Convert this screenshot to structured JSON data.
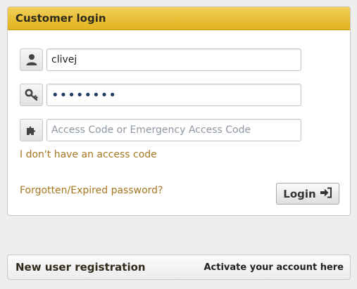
{
  "login_panel": {
    "title": "Customer login",
    "username": {
      "value": "clivej",
      "icon": "user-icon"
    },
    "password": {
      "value": "••••••••",
      "icon": "key-icon"
    },
    "access_code": {
      "placeholder": "Access Code or Emergency Access Code",
      "value": "",
      "icon": "puzzle-icon"
    },
    "no_access_code_link": "I don't have an access code",
    "forgot_password_link": "Forgotten/Expired password?",
    "login_button": {
      "label": "Login",
      "icon": "sign-in-icon"
    }
  },
  "registration_panel": {
    "title": "New user registration",
    "activate_link": "Activate your account here"
  },
  "colors": {
    "header_gold": "#e3b21d",
    "link_gold": "#a67720",
    "background": "#eeeeec"
  }
}
